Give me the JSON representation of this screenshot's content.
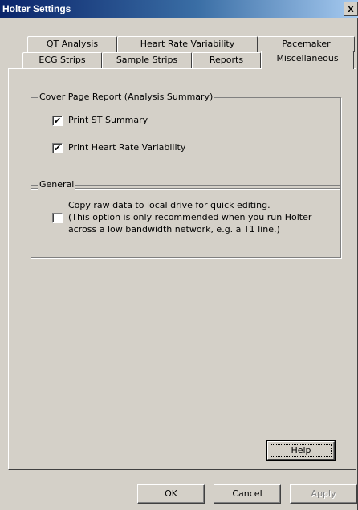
{
  "window": {
    "title": "Holter Settings",
    "close_label": "x"
  },
  "tabs": {
    "row_back": [
      {
        "label": "QT Analysis"
      },
      {
        "label": "Heart Rate Variability"
      },
      {
        "label": "Pacemaker"
      }
    ],
    "row_front": [
      {
        "label": "ECG Strips"
      },
      {
        "label": "Sample Strips"
      },
      {
        "label": "Reports"
      },
      {
        "label": "Miscellaneous",
        "active": true
      }
    ]
  },
  "cover_page": {
    "title": "Cover Page Report (Analysis Summary)",
    "options": [
      {
        "label": "Print ST Summary",
        "checked": true
      },
      {
        "label": "Print Heart Rate Variability",
        "checked": true
      }
    ]
  },
  "general": {
    "title": "General",
    "option": {
      "checked": false,
      "lines": [
        "Copy raw data to local drive for quick editing.",
        "(This option is only recommended when you run Holter",
        "across a low bandwidth network, e.g. a T1 line.)"
      ]
    }
  },
  "buttons": {
    "help": "Help",
    "ok": "OK",
    "cancel": "Cancel",
    "apply": "Apply"
  },
  "check_mark": "✔"
}
